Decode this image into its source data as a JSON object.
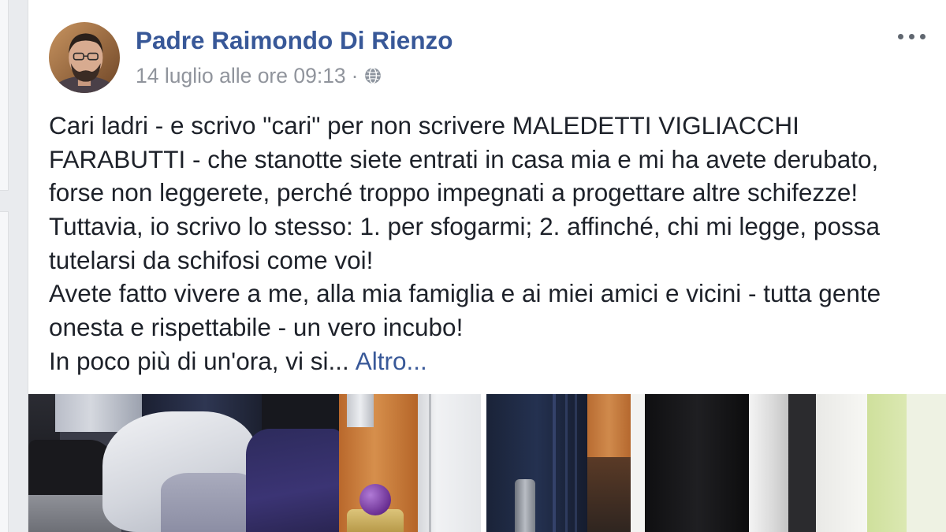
{
  "post": {
    "author_name": "Padre Raimondo Di Rienzo",
    "timestamp": "14 luglio alle ore 09:13",
    "separator": "·",
    "audience_icon": "globe-icon",
    "menu_icon": "more-options-icon",
    "text_lines": [
      "Cari ladri - e scrivo \"cari\" per non scrivere MALEDETTI VIGLIACCHI",
      "FARABUTTI - che stanotte siete entrati in casa mia e mi ha avete derubato,",
      "forse non leggerete, perché troppo impegnati a progettare altre schifezze!",
      "Tuttavia, io scrivo lo stesso: 1. per sfogarmi; 2. affinché, chi mi legge, possa",
      "tutelarsi da schifosi come voi!",
      "Avete fatto vivere a me, alla mia famiglia e ai miei amici e vicini - tutta gente",
      "onesta e rispettabile - un vero incubo!"
    ],
    "truncated_text": "In poco più di un'ora, vi si...",
    "see_more_label": "Altro..."
  },
  "theme": {
    "background": "#e9ebee",
    "card": "#ffffff",
    "link_color": "#385898",
    "text_color": "#1d2129",
    "meta_color": "#90949c"
  }
}
